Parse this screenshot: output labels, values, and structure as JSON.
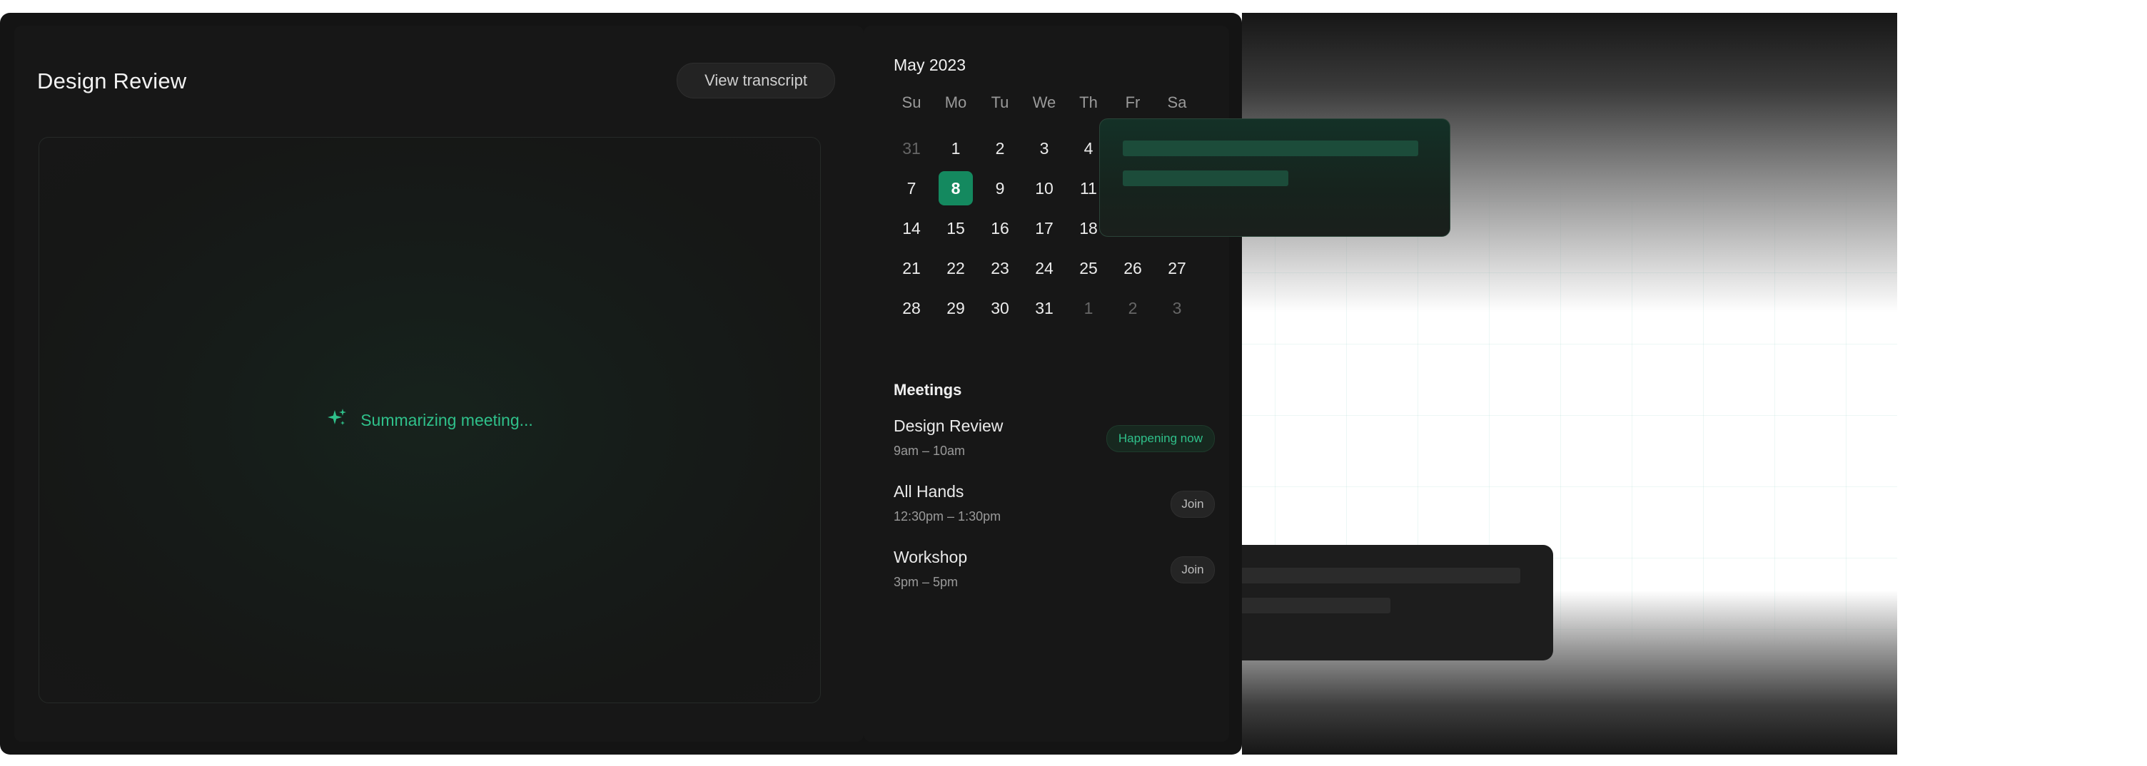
{
  "page": {
    "title": "Design Review",
    "view_transcript_label": "View transcript"
  },
  "summary": {
    "status_text": "Summarizing meeting...",
    "icon": "sparkle-icon"
  },
  "calendar": {
    "month_label": "May 2023",
    "weekdays": [
      "Su",
      "Mo",
      "Tu",
      "We",
      "Th",
      "Fr",
      "Sa"
    ],
    "weeks": [
      [
        "31",
        "1",
        "2",
        "3",
        "4",
        "",
        ""
      ],
      [
        "7",
        "8",
        "9",
        "10",
        "11",
        "",
        ""
      ],
      [
        "14",
        "15",
        "16",
        "17",
        "18",
        "",
        ""
      ],
      [
        "21",
        "22",
        "23",
        "24",
        "25",
        "26",
        "27"
      ],
      [
        "28",
        "29",
        "30",
        "31",
        "1",
        "2",
        "3"
      ]
    ],
    "selected_day": "8"
  },
  "meetings": {
    "title": "Meetings",
    "items": [
      {
        "name": "Design Review",
        "time": "9am – 10am",
        "action": "Happening now"
      },
      {
        "name": "All Hands",
        "time": "12:30pm – 1:30pm",
        "action": "Join"
      },
      {
        "name": "Workshop",
        "time": "3pm – 5pm",
        "action": "Join"
      }
    ]
  },
  "colors": {
    "accent": "#14895f",
    "accent_text": "#2fc08a",
    "window_bg": "#141414",
    "panel_bg": "#171717"
  }
}
